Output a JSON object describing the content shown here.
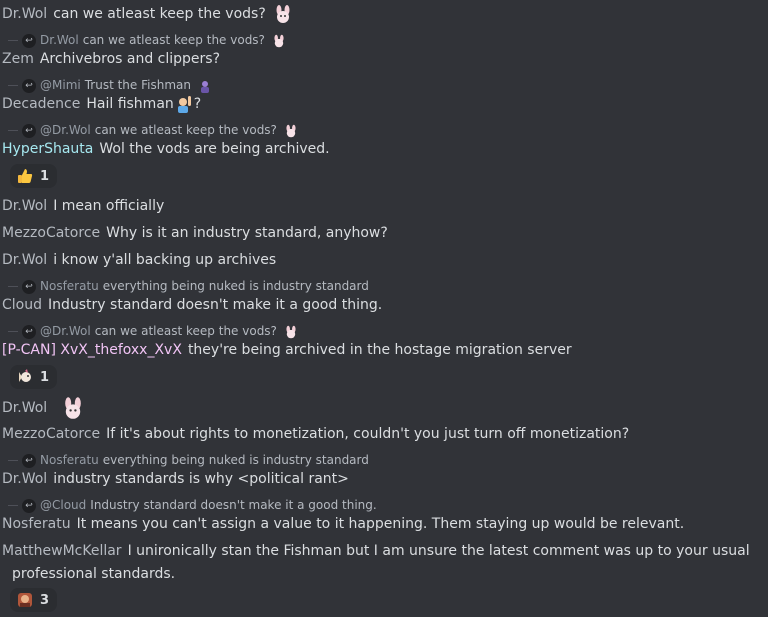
{
  "messages": [
    {
      "author": "Dr.Wol",
      "author_color": "#b5bac1",
      "text": "can we atleast keep the vods?",
      "emoji": "bunny-emoji"
    },
    {
      "reply_to": "Dr.Wol",
      "reply_text": "can we atleast keep the vods?",
      "author": "Zem",
      "author_color": "#b5bac1",
      "text": "Archivebros and clippers?"
    },
    {
      "reply_to": "@Mimi",
      "reply_text": "Trust the Fishman",
      "author": "Decadence",
      "author_color": "#b5bac1",
      "text": "Hail fishman",
      "trailing": "?"
    },
    {
      "reply_to": "@Dr.Wol",
      "reply_text": "can we atleast keep the vods?",
      "author": "HyperShauta",
      "author_color": "#a6e8f0",
      "text": "Wol the vods are being archived.",
      "reaction_count": "1"
    },
    {
      "author": "Dr.Wol",
      "author_color": "#b5bac1",
      "text": "I mean officially"
    },
    {
      "author": "MezzoCatorce",
      "author_color": "#b5bac1",
      "text": "Why is it an industry standard, anyhow?"
    },
    {
      "author": "Dr.Wol",
      "author_color": "#b5bac1",
      "text": "i know y'all backing up archives"
    },
    {
      "reply_to": "Nosferatu",
      "reply_text": "everything being nuked is industry standard",
      "author": "Cloud",
      "author_color": "#b5bac1",
      "text": "Industry standard doesn't make it a good thing."
    },
    {
      "reply_to": "@Dr.Wol",
      "reply_text": "can we atleast keep the vods?",
      "author": "[P-CAN] XvX_thefoxx_XvX",
      "author_color": "#f1c4f5",
      "text": "they're being archived in the hostage migration server",
      "reaction_count": "1"
    },
    {
      "author": "Dr.Wol",
      "author_color": "#b5bac1",
      "text": ""
    },
    {
      "author": "MezzoCatorce",
      "author_color": "#b5bac1",
      "text": "If it's about rights to monetization, couldn't you just turn off monetization?"
    },
    {
      "reply_to": "Nosferatu",
      "reply_text": "everything being nuked is industry standard",
      "author": "Dr.Wol",
      "author_color": "#b5bac1",
      "text": "industry standards is why <political rant>"
    },
    {
      "reply_to": "@Cloud",
      "reply_text": "Industry standard doesn't make it a good thing.",
      "author": "Nosferatu",
      "author_color": "#b5bac1",
      "text": "It means you can't assign a value to it happening. Them staying up would be relevant."
    },
    {
      "author": "MatthewMcKellar",
      "author_color": "#b5bac1",
      "text": "I unironically stan the Fishman but I am unsure the latest comment was up to your usual",
      "text_cont": "professional standards.",
      "reaction_count": "3"
    }
  ],
  "colors": {
    "background": "#313338",
    "reaction_bg": "#2b2d31",
    "text": "#dbdee1",
    "muted": "#b5bac1"
  }
}
